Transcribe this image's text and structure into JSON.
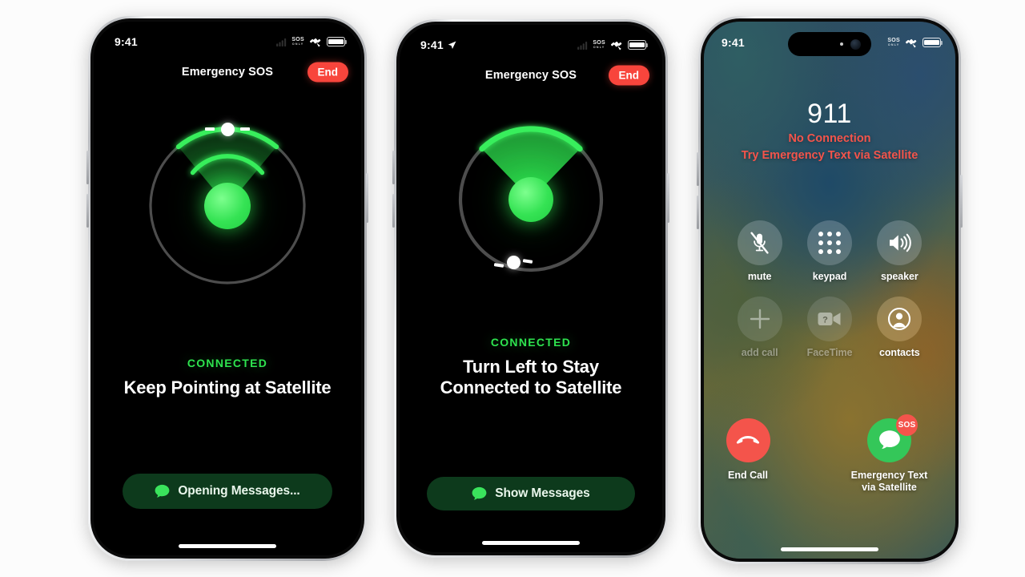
{
  "scene": {
    "background": "#fcfcfc",
    "accent_green": "#2ee34f",
    "accent_red": "#f4544b",
    "frame_color": "#c9cbcf"
  },
  "phones": [
    {
      "id": "phone-pointing",
      "status_bar": {
        "time": "9:41",
        "location_arrow": false,
        "sos_label": "SOS",
        "sos_sub": "ONLY",
        "satellite_icon": "satellite-icon",
        "battery_icon": "battery-icon"
      },
      "header": {
        "title": "Emergency SOS",
        "end_label": "End"
      },
      "dial": {
        "kind": "pointing-at-satellite",
        "marker_angle_deg": 0,
        "beam_span_deg": 74,
        "rings": 2,
        "track_color": "#4a4a4a",
        "beam_color": "#2ee34f"
      },
      "status": {
        "connected_label": "CONNECTED",
        "headline": "Keep Pointing at Satellite"
      },
      "pill": {
        "icon": "message-bubble-icon",
        "label": "Opening Messages..."
      }
    },
    {
      "id": "phone-turn-left",
      "status_bar": {
        "time": "9:41",
        "location_arrow": true,
        "sos_label": "SOS",
        "sos_sub": "ONLY",
        "satellite_icon": "satellite-icon",
        "battery_icon": "battery-icon"
      },
      "header": {
        "title": "Emergency SOS",
        "end_label": "End"
      },
      "dial": {
        "kind": "turn-left",
        "marker_angle_deg": 186,
        "beam_span_deg": 78,
        "rings": 0,
        "track_color": "#4a4a4a",
        "beam_color": "#2ee34f"
      },
      "status": {
        "connected_label": "CONNECTED",
        "headline": "Turn Left to Stay Connected to Satellite"
      },
      "pill": {
        "icon": "message-bubble-icon",
        "label": "Show Messages"
      }
    },
    {
      "id": "phone-call",
      "status_bar": {
        "time": "9:41",
        "sos_label": "SOS",
        "sos_sub": "ONLY",
        "satellite_icon": "satellite-icon",
        "battery_icon": "battery-icon"
      },
      "call": {
        "number": "911",
        "line1": "No Connection",
        "line2": "Try Emergency Text via Satellite"
      },
      "controls": [
        {
          "name": "mute",
          "label": "mute",
          "icon": "mic-muted-icon",
          "enabled": true
        },
        {
          "name": "keypad",
          "label": "keypad",
          "icon": "keypad-icon",
          "enabled": true
        },
        {
          "name": "speaker",
          "label": "speaker",
          "icon": "speaker-icon",
          "enabled": true
        },
        {
          "name": "add-call",
          "label": "add call",
          "icon": "plus-icon",
          "enabled": false
        },
        {
          "name": "facetime",
          "label": "FaceTime",
          "icon": "video-camera-icon",
          "enabled": false
        },
        {
          "name": "contacts",
          "label": "contacts",
          "icon": "person-circle-icon",
          "enabled": true
        }
      ],
      "actions": [
        {
          "name": "end-call",
          "label": "End Call",
          "icon": "phone-down-icon",
          "color": "#f4544b",
          "badge": null
        },
        {
          "name": "emergency-text",
          "label": "Emergency Text via Satellite",
          "icon": "message-bubble-icon",
          "color": "#34c759",
          "badge": "SOS"
        }
      ]
    }
  ]
}
